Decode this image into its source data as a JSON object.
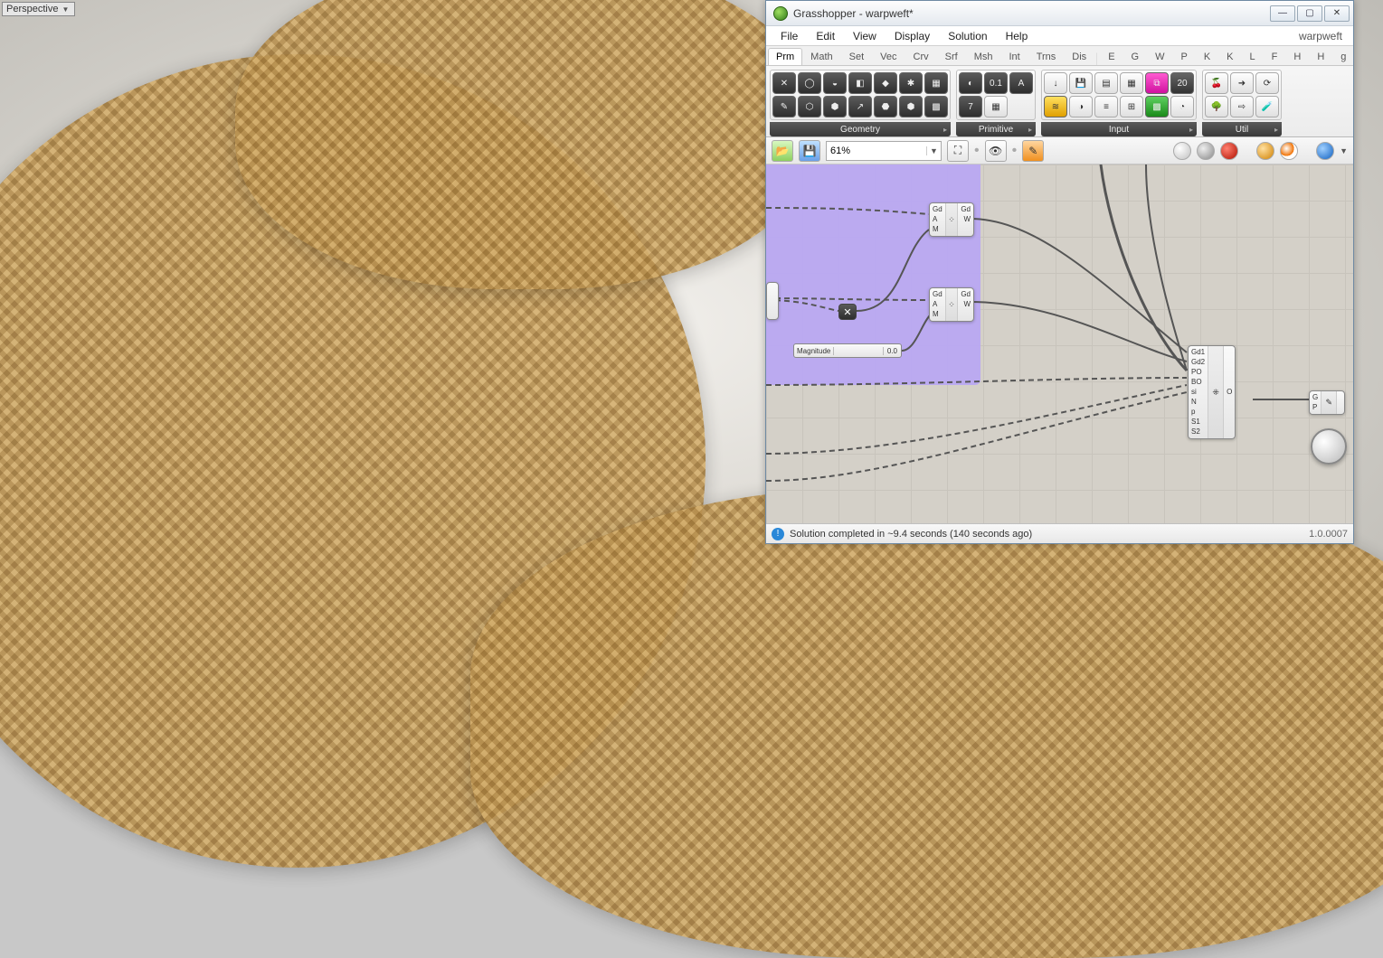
{
  "viewport_label": "Perspective",
  "window": {
    "title": "Grasshopper - warpweft*",
    "project_name": "warpweft"
  },
  "menus": [
    "File",
    "Edit",
    "View",
    "Display",
    "Solution",
    "Help"
  ],
  "tabs": [
    "Prm",
    "Math",
    "Set",
    "Vec",
    "Crv",
    "Srf",
    "Msh",
    "Int",
    "Trns",
    "Dis",
    "E",
    "G",
    "W",
    "P",
    "K",
    "K",
    "L",
    "F",
    "H",
    "H",
    "g"
  ],
  "active_tab": "Prm",
  "ribbon_panels": [
    {
      "name": "Geometry"
    },
    {
      "name": "Primitive"
    },
    {
      "name": "Input"
    },
    {
      "name": "Util"
    }
  ],
  "zoom": "61%",
  "status": "Solution completed in ~9.4 seconds (140 seconds ago)",
  "version": "1.0.0007",
  "canvas": {
    "slider_magnitude": {
      "label": "Magnitude",
      "value": "0.0"
    },
    "node1": {
      "in": [
        "Gd",
        "A",
        "M"
      ],
      "out": [
        "Gd",
        "W"
      ]
    },
    "node2": {
      "in": [
        "Gd",
        "A",
        "M"
      ],
      "out": [
        "Gd",
        "W"
      ]
    },
    "bignode": {
      "in": [
        "Gd1",
        "Gd2",
        "PO",
        "BO",
        "si",
        "N",
        "p",
        "S1",
        "S2"
      ],
      "out": [
        "O"
      ]
    },
    "preview_node": {
      "in": [
        "G",
        "P"
      ]
    }
  }
}
